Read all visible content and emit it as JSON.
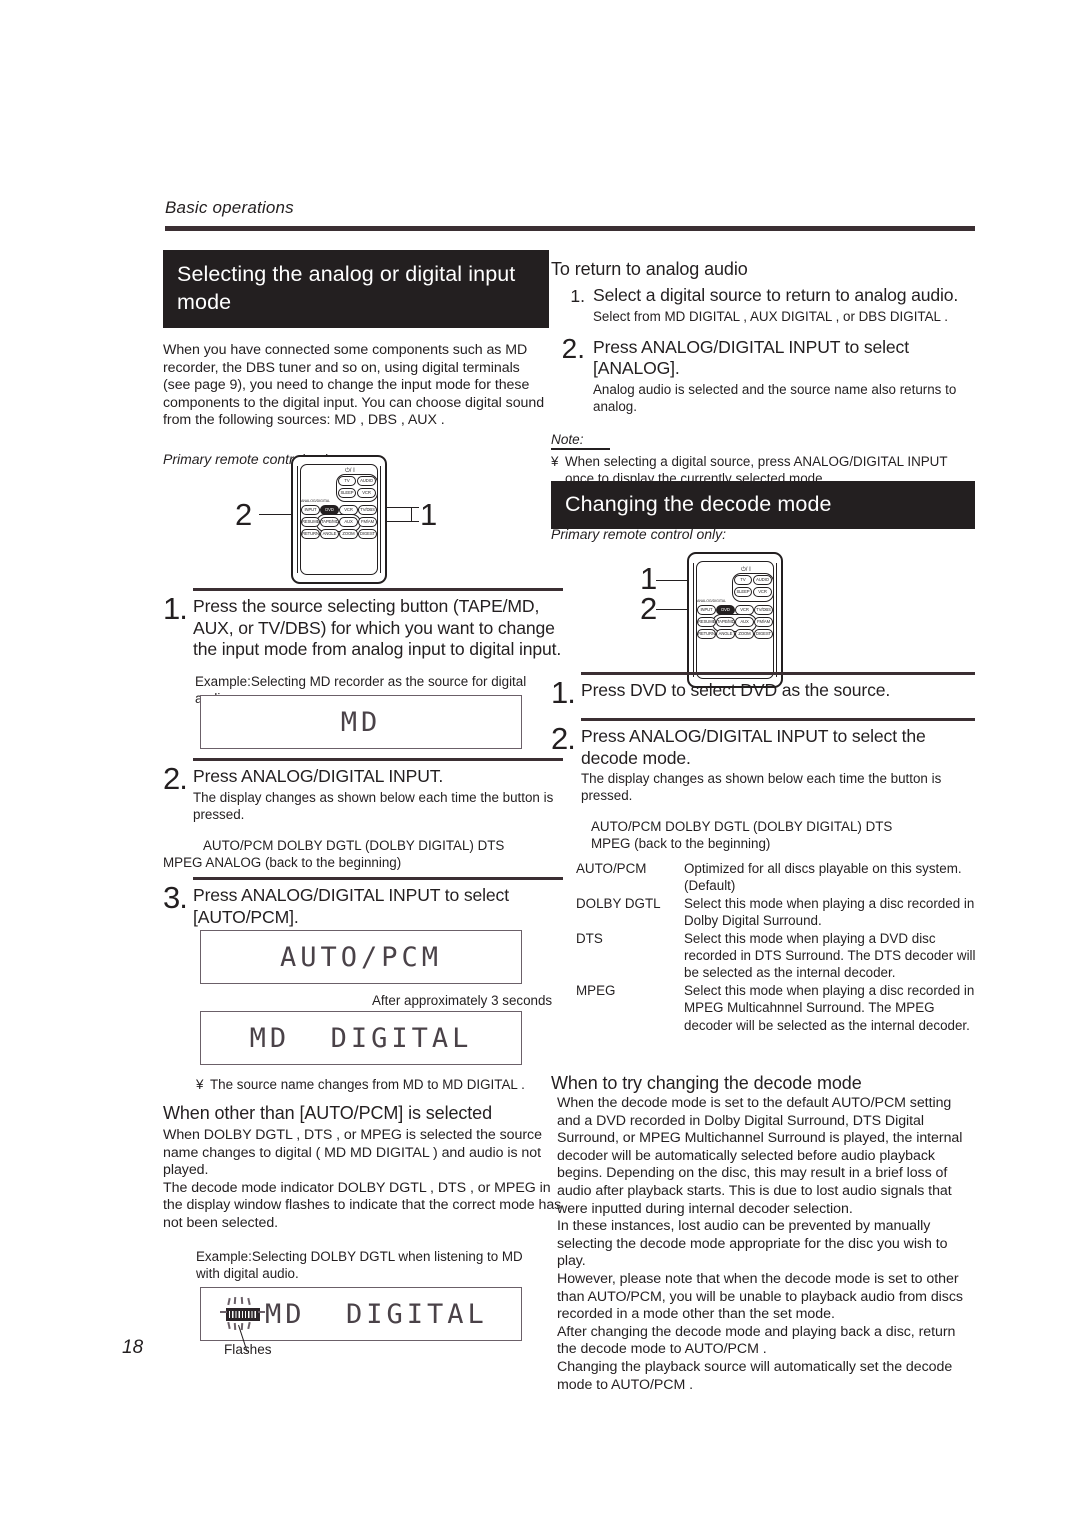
{
  "header": {
    "running_head": "Basic operations"
  },
  "folio": "18",
  "left_column": {
    "banner_title": "Selecting the analog or digital input mode",
    "intro": "When you have connected some components such as MD recorder,  the  DBS tuner and so on, using digital terminals (see page 9), you need to change the input mode for these components to the digital input. You can choose digital sound from the following sources:  MD ,  DBS ,  AUX .",
    "remote_caption": "Primary remote control only:",
    "remote": {
      "callout_left": "2",
      "callout_right": "1",
      "analog_digital_label": "ANALOG/DIGITAL",
      "power_glyph": "⏻/ I",
      "buttons": [
        "TV",
        "AUDIO",
        "SLEEP",
        "VCR",
        "INPUT",
        "DVD",
        "VCR",
        "TV/DBS",
        "RESUME",
        "TAPE/MD",
        "AUX",
        "FM/AM",
        "RETURN",
        "ANGLE",
        "ZOOM",
        "DIGEST"
      ]
    },
    "step1": {
      "number": "1.",
      "title": "Press the source selecting button (TAPE/MD, AUX, or TV/DBS) for which you want to change the input mode from analog input to digital input.",
      "example": "Example:Selecting MD recorder as the source for digital audio.",
      "display": "MD"
    },
    "step2": {
      "number": "2.",
      "title": "Press ANALOG/DIGITAL INPUT.",
      "sub": "The display changes as shown below each time the button is pressed.",
      "sequence_line1": "AUTO/PCM   DOLBY DGTL (DOLBY DIGITAL)  DTS",
      "sequence_line2": "MPEG    ANALOG   (back to the beginning)"
    },
    "step3": {
      "number": "3.",
      "title": "Press ANALOG/DIGITAL INPUT to select [AUTO/PCM].",
      "display_first": "AUTO/PCM",
      "between_caption": "After approximately 3 seconds",
      "display_second": "MD  DIGITAL"
    },
    "source_note": {
      "mark": "¥",
      "text": "The source name changes from  MD  to  MD DIGITAL ."
    },
    "other_than": {
      "heading": "When other than [AUTO/PCM] is selected",
      "para1": "When  DOLBY DGTL ,  DTS , or   MPEG  is selected the source name changes to digital ( MD      MD DIGITAL ) and audio is not played.",
      "para2": "The decode mode indicator  DOLBY DGTL ,  DTS , or   MPEG  in the display window flashes to indicate that the correct mode has not been selected.",
      "example": "Example:Selecting  DOLBY DGTL  when listening to MD with digital audio.",
      "display": "MD  DIGITAL",
      "flashes_label": "Flashes"
    }
  },
  "right_column": {
    "return_analog": {
      "heading": "To return to analog audio",
      "step1": {
        "number": "1.",
        "title": "Select a digital source to return to analog audio.",
        "sub": "Select from  MD DIGITAL ,  AUX DIGITAL , or  DBS DIGITAL ."
      },
      "step2": {
        "number": "2.",
        "title": "Press ANALOG/DIGITAL INPUT to select [ANALOG].",
        "sub": "Analog audio is selected and the source name also returns to analog."
      }
    },
    "note": {
      "label": "Note:",
      "mark": "¥",
      "text": "When selecting a digital source, press ANALOG/DIGITAL INPUT once to display the currently selected mode."
    },
    "banner_title": "Changing the decode mode",
    "remote_caption": "Primary remote control only:",
    "remote": {
      "callout_top": "1",
      "callout_bottom": "2",
      "analog_digital_label": "ANALOG/DIGITAL",
      "power_glyph": "⏻/ I",
      "buttons": [
        "TV",
        "AUDIO",
        "SLEEP",
        "VCR",
        "INPUT",
        "DVD",
        "VCR",
        "TV/DBS",
        "RESUME",
        "TAPE/MD",
        "AUX",
        "FM/AM",
        "RETURN",
        "ANGLE",
        "ZOOM",
        "DIGEST"
      ]
    },
    "step1": {
      "number": "1.",
      "title": "Press DVD to select DVD as the source."
    },
    "step2": {
      "number": "2.",
      "title": "Press ANALOG/DIGITAL INPUT to select the decode mode.",
      "sub": "The display changes as shown below each time the button is pressed.",
      "sequence_line1": "AUTO/PCM   DOLBY DGTL (DOLBY DIGITAL)  DTS",
      "sequence_line2": "MPEG    (back to the beginning)"
    },
    "decode_modes": [
      {
        "term": "AUTO/PCM",
        "desc": "Optimized for all discs playable on this system. (Default)"
      },
      {
        "term": "DOLBY DGTL",
        "desc": "Select this mode when playing a disc recorded in Dolby Digital Surround."
      },
      {
        "term": "DTS",
        "desc": "Select this mode when playing a DVD disc recorded in DTS Surround. The DTS decoder will be selected as the internal decoder."
      },
      {
        "term": "MPEG",
        "desc": "Select this mode when playing a disc recorded in MPEG Multicahnnel Surround. The MPEG decoder will be selected as the internal decoder."
      }
    ],
    "when_to_try": {
      "heading": "When to try changing the decode mode",
      "paragraphs": [
        "When the decode mode is set to the default AUTO/PCM setting and a DVD recorded in Dolby Digital Surround, DTS Digital Surround, or MPEG Multichannel Surround is played, the internal decoder will be automatically selected before audio playback begins. Depending on the disc, this may result in a brief loss of audio after playback starts. This is due to lost audio signals that were inputted during internal decoder selection.",
        "In these instances, lost audio can be prevented by manually selecting the decode mode appropriate for the disc you wish to play.",
        "However, please note that when the decode mode is set to other than AUTO/PCM, you will be unable to playback audio from discs recorded in a mode other than the set mode.",
        "After changing the decode mode and playing back a disc, return the decode mode to  AUTO/PCM .",
        "Changing the playback source will automatically set the decode mode to  AUTO/PCM ."
      ]
    }
  },
  "colors": {
    "ink": "#231f20",
    "banner_bg": "#231f20",
    "lcd_border": "#6b6068",
    "lcd_text": "#4a4248"
  }
}
